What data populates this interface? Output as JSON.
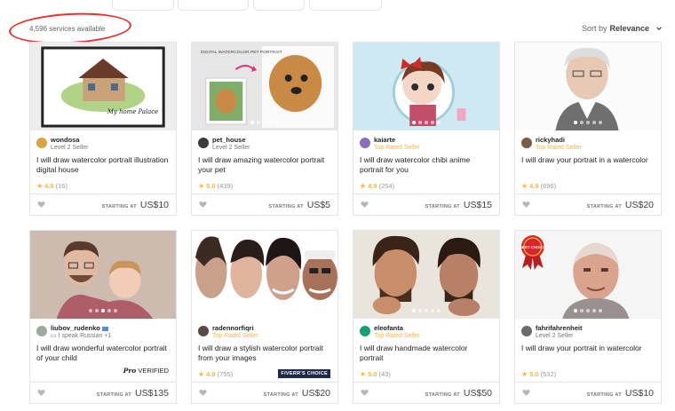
{
  "results": {
    "count_text": "4,596 services available"
  },
  "sort": {
    "label": "Sort by",
    "value": "Relevance"
  },
  "colors": {
    "accent_star": "#ffb33e",
    "annotation_circle": "#e8322f",
    "fiverrs_choice_bg": "#1e2a48"
  },
  "cards": [
    {
      "seller": "wondosa",
      "level": "Level 2 Seller",
      "level_top": false,
      "title": "I will draw watercolor portrait illustration digital house",
      "rating": "4.9",
      "reviews": "(16)",
      "starting": "STARTING AT",
      "price": "US$10",
      "badge": "",
      "avatar_color": "#d9a441",
      "thumb": "house"
    },
    {
      "seller": "pet_house",
      "level": "Level 2 Seller",
      "level_top": false,
      "title": "I will draw amazing watercolor portrait your pet",
      "rating": "5.0",
      "reviews": "(439)",
      "starting": "STARTING AT",
      "price": "US$5",
      "badge": "",
      "avatar_color": "#3b3b3b",
      "thumb": "pet"
    },
    {
      "seller": "kaiarte",
      "level": "Top Rated Seller",
      "level_top": true,
      "title": "I will draw watercolor chibi anime portrait for you",
      "rating": "4.9",
      "reviews": "(254)",
      "starting": "STARTING AT",
      "price": "US$15",
      "badge": "",
      "avatar_color": "#8a6fb8",
      "thumb": "chibi"
    },
    {
      "seller": "rickyhadi",
      "level": "Top Rated Seller",
      "level_top": true,
      "title": "I will draw your portrait in a watercolor",
      "rating": "4.9",
      "reviews": "(696)",
      "starting": "STARTING AT",
      "price": "US$20",
      "badge": "",
      "avatar_color": "#7a5c4a",
      "thumb": "old-man"
    },
    {
      "seller": "liubov_rudenko",
      "level": "I speak Russian +1",
      "level_top": false,
      "title": "I will draw wonderful watercolor portrait of your child",
      "rating": "",
      "reviews": "",
      "starting": "STARTING AT",
      "price": "US$135",
      "badge": "pro",
      "badge_text_pro": "Pro",
      "badge_text_verified": "VERIFIED",
      "avatar_color": "#9ba9a0",
      "thumb": "family"
    },
    {
      "seller": "radennorfiqri",
      "level": "Top Rated Seller",
      "level_top": true,
      "title": "I will draw a stylish watercolor portrait from your images",
      "rating": "4.9",
      "reviews": "(755)",
      "starting": "STARTING AT",
      "price": "US$20",
      "badge": "choice",
      "badge_text_choice": "FIVERR'S CHOICE",
      "avatar_color": "#5a4a42",
      "thumb": "faces"
    },
    {
      "seller": "eleofanta",
      "level": "Top Rated Seller",
      "level_top": true,
      "title": "I will draw handmade watercolor portrait",
      "rating": "5.0",
      "reviews": "(43)",
      "starting": "STARTING AT",
      "price": "US$50",
      "badge": "",
      "avatar_color": "#1a9e6e",
      "thumb": "men"
    },
    {
      "seller": "fahrifahrenheit",
      "level": "Level 2 Seller",
      "level_top": false,
      "title": "I will draw your portrait in watercolor",
      "rating": "5.0",
      "reviews": "(532)",
      "starting": "STARTING AT",
      "price": "US$10",
      "badge": "",
      "avatar_color": "#6b6b6b",
      "thumb": "bald",
      "thumb_badge_text": "BEST CHOICE"
    }
  ]
}
